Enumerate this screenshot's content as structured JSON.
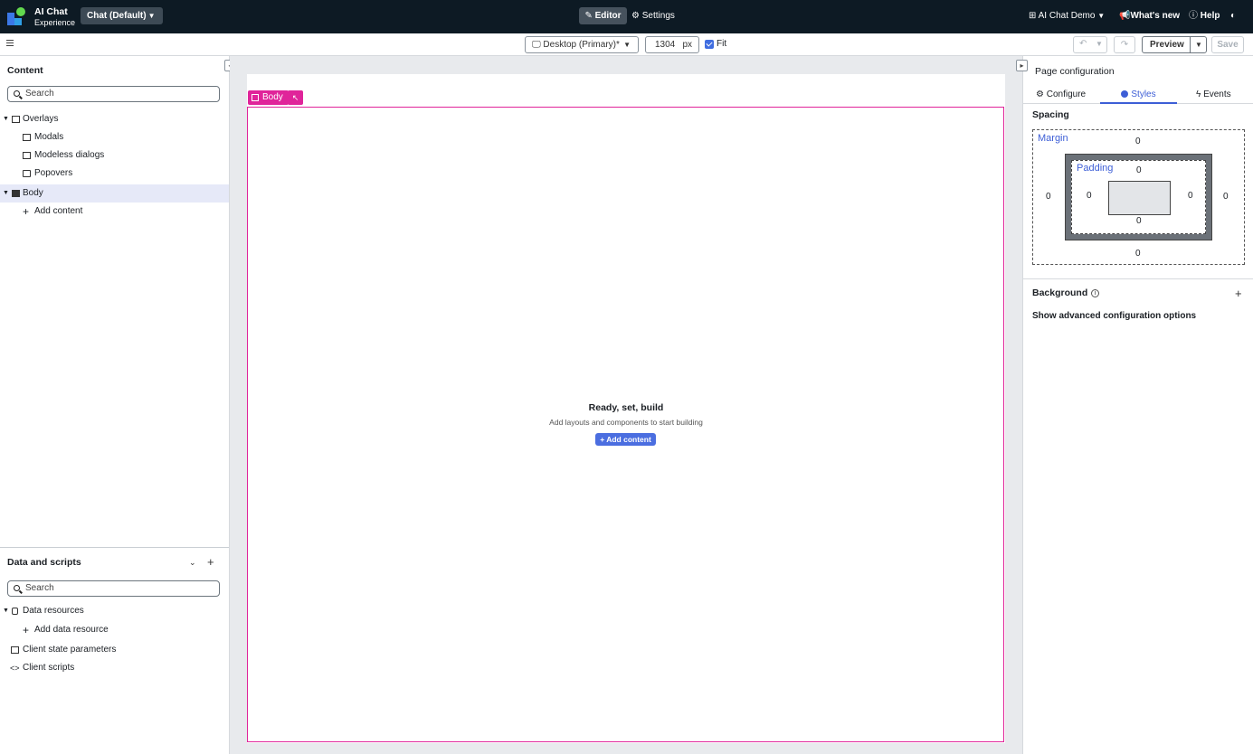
{
  "app": {
    "name": "AI Chat",
    "subtitle": "Experience",
    "variant_label": "Chat (Default)"
  },
  "topbar": {
    "editor_label": "Editor",
    "settings_label": "Settings",
    "demo_label": "AI Chat Demo",
    "whats_new_label": "What's new",
    "help_label": "Help"
  },
  "toolbar": {
    "device_label": "Desktop (Primary)*",
    "width_value": "1304",
    "width_unit": "px",
    "fit_label": "Fit",
    "fit_checked": true,
    "preview_label": "Preview",
    "save_label": "Save"
  },
  "content_panel": {
    "title": "Content",
    "search_placeholder": "Search",
    "tree": {
      "overlays": "Overlays",
      "modals": "Modals",
      "modeless": "Modeless dialogs",
      "popovers": "Popovers",
      "body": "Body",
      "add_content": "Add content"
    }
  },
  "data_panel": {
    "title": "Data and scripts",
    "search_placeholder": "Search",
    "items": {
      "data_resources": "Data resources",
      "add_data_resource": "Add data resource",
      "client_state": "Client state parameters",
      "client_scripts": "Client scripts"
    }
  },
  "canvas": {
    "body_tag": "Body",
    "empty_title": "Ready, set, build",
    "empty_subtitle": "Add layouts and components to start building",
    "add_button": "+ Add content"
  },
  "config_panel": {
    "title": "Page configuration",
    "tabs": {
      "configure": "Configure",
      "styles": "Styles",
      "events": "Events"
    },
    "active_tab": "Styles",
    "spacing_title": "Spacing",
    "margin_label": "Margin",
    "padding_label": "Padding",
    "margin": {
      "top": "0",
      "right": "0",
      "bottom": "0",
      "left": "0"
    },
    "padding": {
      "top": "0",
      "right": "0",
      "bottom": "0",
      "left": "0"
    },
    "background_title": "Background",
    "advanced_label": "Show advanced configuration options"
  },
  "colors": {
    "topbar_bg": "#0d1a24",
    "accent": "#3d5ed6",
    "body_highlight": "#e0249a",
    "canvas_bg": "#e8eaed"
  }
}
